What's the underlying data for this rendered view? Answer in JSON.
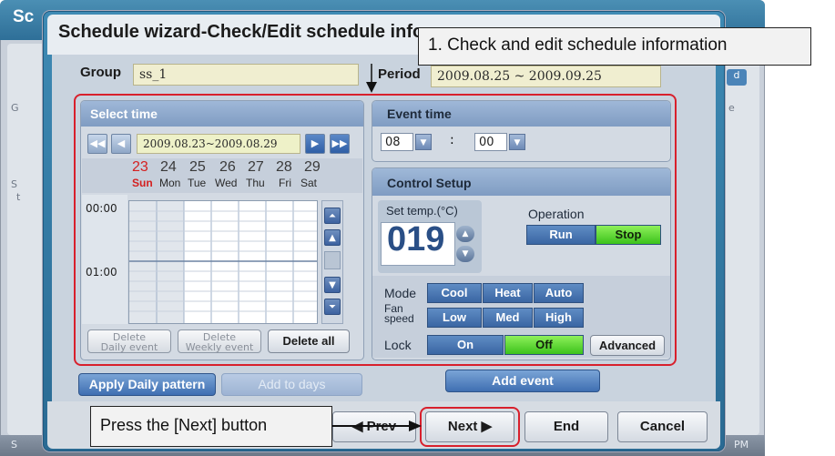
{
  "background": {
    "title": "Sc",
    "side_g": "G",
    "side_s": "S",
    "side_t": "t",
    "side_e": "e",
    "side_d": "d",
    "footer_left": "S",
    "footer_right": "PM"
  },
  "dialog": {
    "title": "Schedule wizard-Check/Edit schedule info",
    "group_label": "Group",
    "group_value": "ss_1",
    "period_label": "Period",
    "period_value": "2009.08.25 ~ 2009.09.25"
  },
  "select_time": {
    "header": "Select time",
    "date_range": "2009.08.23~2009.08.29",
    "days": [
      {
        "num": "23",
        "name": "Sun"
      },
      {
        "num": "24",
        "name": "Mon"
      },
      {
        "num": "25",
        "name": "Tue"
      },
      {
        "num": "26",
        "name": "Wed"
      },
      {
        "num": "27",
        "name": "Thu"
      },
      {
        "num": "28",
        "name": "Fri"
      },
      {
        "num": "29",
        "name": "Sat"
      }
    ],
    "time_labels": [
      "00:00",
      "01:00"
    ],
    "delete_daily": "Delete\nDaily event",
    "delete_weekly": "Delete\nWeekly event",
    "delete_all": "Delete all"
  },
  "event_time": {
    "header": "Event time",
    "hour": "08",
    "separator": ":",
    "minute": "00"
  },
  "control_setup": {
    "header": "Control Setup",
    "set_temp_label": "Set temp.(°C)",
    "set_temp_value": "019",
    "operation_label": "Operation",
    "operation_options": [
      "Run",
      "Stop"
    ],
    "operation_selected": "Stop",
    "mode_label": "Mode",
    "mode_options": [
      "Cool",
      "Heat",
      "Auto"
    ],
    "fan_label": "Fan\nspeed",
    "fan_options": [
      "Low",
      "Med",
      "High"
    ],
    "lock_label": "Lock",
    "lock_options": [
      "On",
      "Off"
    ],
    "lock_selected": "Off",
    "advanced": "Advanced"
  },
  "actions": {
    "apply_daily": "Apply Daily pattern",
    "add_to_days": "Add to days",
    "add_event": "Add event",
    "prev": "◀ Prev",
    "next": "Next ▶",
    "end": "End",
    "cancel": "Cancel"
  },
  "annotations": {
    "callout_top": "1. Check and edit schedule information",
    "callout_bottom": "Press the [Next] button"
  },
  "colors": {
    "red_highlight": "#d8202c",
    "green_selected": "#3cc21b",
    "sunday_red": "#d42020"
  }
}
